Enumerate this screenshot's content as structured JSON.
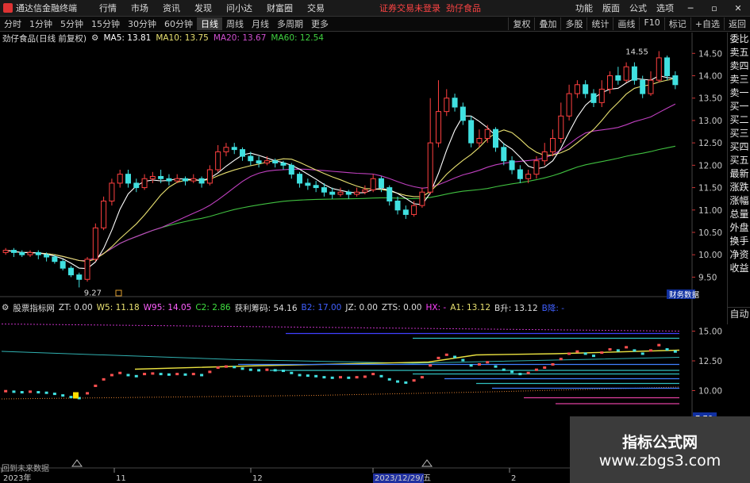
{
  "app": {
    "title": "通达信金融终端",
    "notice": "证券交易未登录",
    "stock": "劲仔食品"
  },
  "menu": [
    "行情",
    "市场",
    "资讯",
    "发现",
    "问小达",
    "财富圈",
    "交易"
  ],
  "menu_right": [
    "功能",
    "版面",
    "公式",
    "选项"
  ],
  "window_controls": [
    "minimize-icon",
    "restore-icon",
    "close-icon"
  ],
  "periods": [
    "分时",
    "1分钟",
    "5分钟",
    "15分钟",
    "30分钟",
    "60分钟",
    "日线",
    "周线",
    "月线",
    "多周期",
    "更多"
  ],
  "active_period": "日线",
  "toolbar_right": [
    "复权",
    "叠加",
    "多股",
    "统计",
    "画线",
    "F10",
    "标记",
    "+自选",
    "返回"
  ],
  "main_header": {
    "title": "劲仔食品(日线 前复权)",
    "ma5": "MA5: 13.81",
    "ma10": "MA10: 13.75",
    "ma20": "MA20: 13.67",
    "ma60": "MA60: 12.54"
  },
  "sidebar_tabs": [
    "委比",
    "卖五",
    "卖四",
    "卖三",
    "卖一",
    "买一",
    "买二",
    "买三",
    "买四",
    "买五",
    "最新",
    "涨跌",
    "涨幅",
    "总量",
    "外盘",
    "换手",
    "净资",
    "收益"
  ],
  "sidebar_auto": "自动",
  "indicator_header": {
    "name": "股票指标网",
    "zt": "ZT: 0.00",
    "w5": "W5: 11.18",
    "w95": "W95: 14.05",
    "c2": "C2: 2.86",
    "profit": "获利筹码: 54.16",
    "b2": "B2: 17.00",
    "jz": "JZ: 0.00",
    "zts": "ZTS: 0.00",
    "hx": "HX: -",
    "a1": "A1: 13.12",
    "b_up": "B升: 13.12",
    "b_label": "B降: -"
  },
  "annotations": {
    "high": "14.55",
    "low": "9.27",
    "finance": "财务数据",
    "sub_price": "7.70"
  },
  "price_axis": [
    "14.50",
    "14.00",
    "13.50",
    "13.00",
    "12.50",
    "12.00",
    "11.50",
    "11.00",
    "10.50",
    "10.00",
    "9.50"
  ],
  "sub_axis": [
    "15.00",
    "12.50",
    "10.00",
    "7.50"
  ],
  "date_axis": [
    "2023年",
    "11",
    "12",
    "2023/12/29/五",
    "2"
  ],
  "no_data": "回到未来数据",
  "watermark": {
    "line1": "指标公式网",
    "line2": "www.zbgs3.com"
  },
  "colors": {
    "up": "#ff4040",
    "down": "#40e0e0",
    "ma5": "#ffffff",
    "ma10": "#e8e070",
    "ma20": "#c040c0",
    "ma60": "#40c040"
  },
  "chart_data": {
    "type": "candlestick",
    "title": "劲仔食品(日线 前复权)",
    "ylim": [
      9.1,
      14.7
    ],
    "candles": [
      [
        10.05,
        10.1,
        10.0,
        10.15
      ],
      [
        10.1,
        10.05,
        9.95,
        10.15
      ],
      [
        10.05,
        10.0,
        9.95,
        10.1
      ],
      [
        10.0,
        10.05,
        9.95,
        10.1
      ],
      [
        10.05,
        10.0,
        9.9,
        10.1
      ],
      [
        10.0,
        9.95,
        9.85,
        10.05
      ],
      [
        9.95,
        9.85,
        9.8,
        10.0
      ],
      [
        9.85,
        9.7,
        9.65,
        9.9
      ],
      [
        9.7,
        9.55,
        9.5,
        9.75
      ],
      [
        9.55,
        9.45,
        9.27,
        9.6
      ],
      [
        9.45,
        9.9,
        9.4,
        9.95
      ],
      [
        9.9,
        10.6,
        9.85,
        10.7
      ],
      [
        10.6,
        11.2,
        10.55,
        11.3
      ],
      [
        11.2,
        11.6,
        11.1,
        11.7
      ],
      [
        11.6,
        11.8,
        11.5,
        11.9
      ],
      [
        11.8,
        11.6,
        11.5,
        11.9
      ],
      [
        11.6,
        11.5,
        11.4,
        11.7
      ],
      [
        11.5,
        11.7,
        11.45,
        11.8
      ],
      [
        11.7,
        11.75,
        11.6,
        11.85
      ],
      [
        11.75,
        11.7,
        11.6,
        11.9
      ],
      [
        11.7,
        11.65,
        11.55,
        11.8
      ],
      [
        11.65,
        11.7,
        11.6,
        11.8
      ],
      [
        11.7,
        11.65,
        11.55,
        11.75
      ],
      [
        11.65,
        11.7,
        11.6,
        11.8
      ],
      [
        11.7,
        11.6,
        11.5,
        11.75
      ],
      [
        11.6,
        11.9,
        11.55,
        12.0
      ],
      [
        11.9,
        12.3,
        11.85,
        12.45
      ],
      [
        12.3,
        12.4,
        12.2,
        12.5
      ],
      [
        12.4,
        12.35,
        12.25,
        12.5
      ],
      [
        12.35,
        12.2,
        12.1,
        12.4
      ],
      [
        12.2,
        12.1,
        12.0,
        12.3
      ],
      [
        12.1,
        12.05,
        11.95,
        12.2
      ],
      [
        12.05,
        12.1,
        12.0,
        12.2
      ],
      [
        12.1,
        12.05,
        11.95,
        12.15
      ],
      [
        12.05,
        12.0,
        11.9,
        12.1
      ],
      [
        12.0,
        11.8,
        11.7,
        12.05
      ],
      [
        11.8,
        11.6,
        11.5,
        11.85
      ],
      [
        11.6,
        11.55,
        11.45,
        11.7
      ],
      [
        11.55,
        11.5,
        11.4,
        11.65
      ],
      [
        11.5,
        11.4,
        11.3,
        11.6
      ],
      [
        11.4,
        11.35,
        11.25,
        11.5
      ],
      [
        11.35,
        11.4,
        11.3,
        11.5
      ],
      [
        11.4,
        11.35,
        11.25,
        11.45
      ],
      [
        11.35,
        11.4,
        11.3,
        11.5
      ],
      [
        11.4,
        11.45,
        11.35,
        11.55
      ],
      [
        11.45,
        11.7,
        11.4,
        11.8
      ],
      [
        11.7,
        11.5,
        11.4,
        11.75
      ],
      [
        11.5,
        11.2,
        11.1,
        11.55
      ],
      [
        11.2,
        11.0,
        10.9,
        11.3
      ],
      [
        11.0,
        10.9,
        10.8,
        11.1
      ],
      [
        10.9,
        11.1,
        10.85,
        11.2
      ],
      [
        11.1,
        11.4,
        11.05,
        11.5
      ],
      [
        11.4,
        12.5,
        11.35,
        13.5
      ],
      [
        12.5,
        13.2,
        12.4,
        13.9
      ],
      [
        13.2,
        13.5,
        13.1,
        13.7
      ],
      [
        13.5,
        13.3,
        13.2,
        13.6
      ],
      [
        13.3,
        13.0,
        12.9,
        13.4
      ],
      [
        13.0,
        12.5,
        12.4,
        13.1
      ],
      [
        12.5,
        12.6,
        12.4,
        12.8
      ],
      [
        12.6,
        12.8,
        12.5,
        12.9
      ],
      [
        12.8,
        12.4,
        12.3,
        12.85
      ],
      [
        12.4,
        12.1,
        12.0,
        12.5
      ],
      [
        12.1,
        11.9,
        11.8,
        12.2
      ],
      [
        11.9,
        11.7,
        11.6,
        12.0
      ],
      [
        11.7,
        11.8,
        11.6,
        11.9
      ],
      [
        11.8,
        12.1,
        11.7,
        12.2
      ],
      [
        12.1,
        12.3,
        12.0,
        12.5
      ],
      [
        12.3,
        12.6,
        12.2,
        12.8
      ],
      [
        12.6,
        13.1,
        12.5,
        13.4
      ],
      [
        13.1,
        13.6,
        13.0,
        13.8
      ],
      [
        13.6,
        13.8,
        13.5,
        13.9
      ],
      [
        13.8,
        13.6,
        13.5,
        13.9
      ],
      [
        13.6,
        13.4,
        13.3,
        13.7
      ],
      [
        13.4,
        13.7,
        13.3,
        13.9
      ],
      [
        13.7,
        14.0,
        13.6,
        14.1
      ],
      [
        14.0,
        13.9,
        13.8,
        14.2
      ],
      [
        13.9,
        14.2,
        13.85,
        14.3
      ],
      [
        14.2,
        13.9,
        13.8,
        14.3
      ],
      [
        13.9,
        13.6,
        13.5,
        14.0
      ],
      [
        13.6,
        13.9,
        13.55,
        14.1
      ],
      [
        13.9,
        14.4,
        13.85,
        14.55
      ],
      [
        14.4,
        14.0,
        13.9,
        14.45
      ],
      [
        14.0,
        13.8,
        13.7,
        14.1
      ]
    ]
  }
}
